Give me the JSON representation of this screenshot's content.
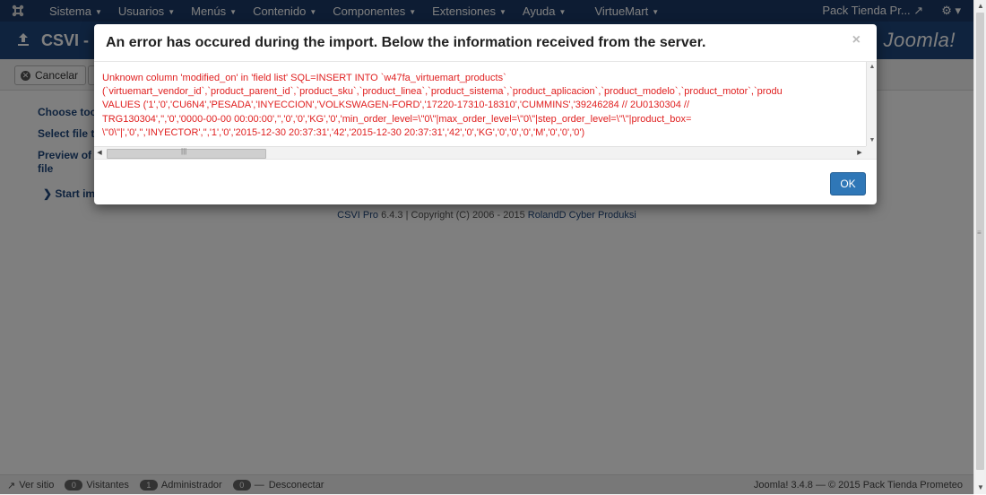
{
  "topbar": {
    "menu": [
      "Sistema",
      "Usuarios",
      "Menús",
      "Contenido",
      "Componentes",
      "Extensiones",
      "Ayuda",
      "VirtueMart"
    ],
    "site_name": "Pack Tienda Pr..."
  },
  "header": {
    "title": "CSVI -",
    "brand": "Joomla!"
  },
  "toolbar": {
    "cancel_label": "Cancelar"
  },
  "page": {
    "links": [
      "Choose too",
      "Select file t",
      "Preview of",
      "file"
    ],
    "start_link": "Start im",
    "credit_prefix": "CSVI Pro",
    "credit_version": "6.4.3 | Copyright (C) 2006 - 2015",
    "credit_author": "RolandD Cyber Produksi"
  },
  "modal": {
    "title": "An error has occured during the import. Below the information received from the server.",
    "close_label": "×",
    "error_lines": [
      "Unknown column 'modified_on' in 'field list' SQL=INSERT INTO `w47fa_virtuemart_products`",
      "(`virtuemart_vendor_id`,`product_parent_id`,`product_sku`,`product_linea`,`product_sistema`,`product_aplicacion`,`product_modelo`,`product_motor`,`produ",
      "VALUES ('1','0','CU6N4','PESADA','INYECCION','VOLKSWAGEN-FORD','17220-17310-18310','CUMMINS','39246284 // 2U0130304 //",
      "TRG130304','','0','0000-00-00 00:00:00','','0','0','KG','0','min_order_level=\\\"0\\\"|max_order_level=\\\"0\\\"|step_order_level=\\\"\\\"|product_box=",
      "\\\"0\\\"|','0','','INYECTOR','','1','0','2015-12-30 20:37:31','42','2015-12-30 20:37:31','42','0','KG','0','0','0','M','0','0','0')"
    ],
    "ok_label": "OK"
  },
  "statusbar": {
    "view_site": "Ver sitio",
    "visitors_count": "0",
    "visitors_label": "Visitantes",
    "admin_count": "1",
    "admin_label": "Administrador",
    "logout_count": "0",
    "logout_label": "Desconectar",
    "right_text": "Joomla! 3.4.8 — © 2015 Pack Tienda Prometeo"
  },
  "colors": {
    "topbar": "#1a3867",
    "header": "#1f477d",
    "error_text": "#e02020",
    "ok_button": "#2f77b7"
  }
}
